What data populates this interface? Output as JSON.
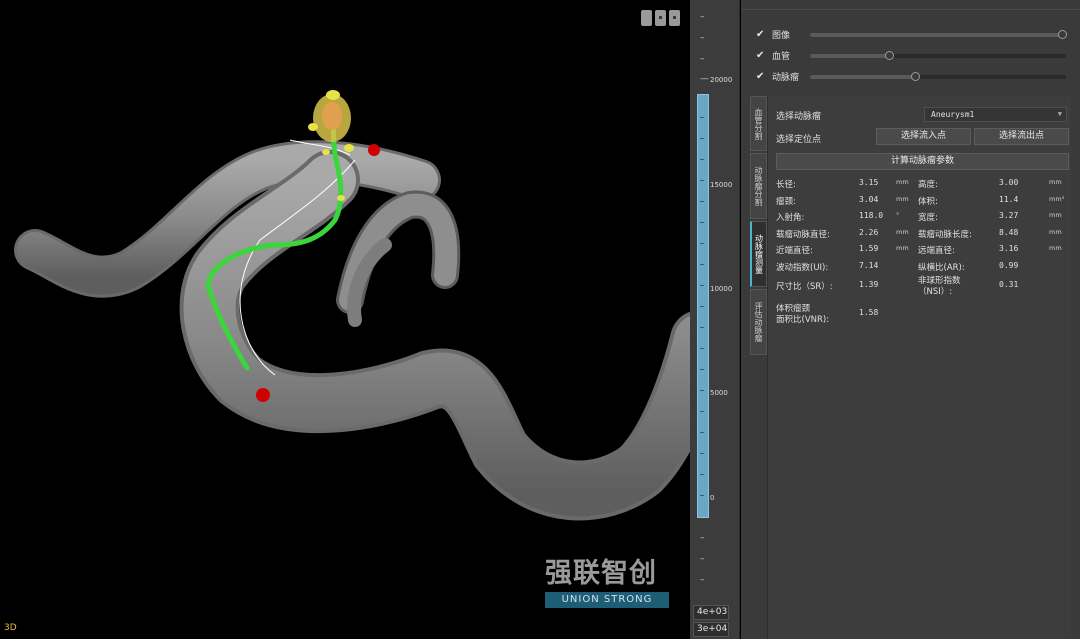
{
  "viewport": {
    "label": "3D",
    "logo_text": "强联智创",
    "logo_sub": "UNION STRONG"
  },
  "colorbar": {
    "labels": [
      "20000",
      "15000",
      "10000",
      "5000",
      "0"
    ],
    "sci_1": "4e+03",
    "sci_2": "3e+04",
    "color": "#6aa7c7"
  },
  "layers": [
    {
      "label": "图像",
      "checked": true,
      "value": 1.0
    },
    {
      "label": "血管",
      "checked": true,
      "value": 0.31
    },
    {
      "label": "动脉瘤",
      "checked": true,
      "value": 0.41
    }
  ],
  "tabs": [
    "血管分割",
    "动脉瘤分割",
    "动脉瘤测量",
    "评估动脉瘤"
  ],
  "active_tab": 2,
  "measure": {
    "select_aneurysm_label": "选择动脉瘤",
    "select_aneurysm_value": "Aneurysm1",
    "select_point_label": "选择定位点",
    "inflow_button": "选择流入点",
    "outflow_button": "选择流出点",
    "compute_button": "计算动脉瘤参数",
    "params": [
      {
        "label": "长径:",
        "value": "3.15",
        "unit": "mm",
        "label2": "高度:",
        "value2": "3.00",
        "unit2": "mm"
      },
      {
        "label": "瘤颈:",
        "value": "3.04",
        "unit": "mm",
        "label2": "体积:",
        "value2": "11.4",
        "unit2": "mm³"
      },
      {
        "label": "入射角:",
        "value": "118.0",
        "unit": "°",
        "label2": "宽度:",
        "value2": "3.27",
        "unit2": "mm"
      },
      {
        "label": "载瘤动脉直径:",
        "value": "2.26",
        "unit": "mm",
        "label2": "载瘤动脉长度:",
        "value2": "8.48",
        "unit2": "mm"
      },
      {
        "label": "近端直径:",
        "value": "1.59",
        "unit": "mm",
        "label2": "远端直径:",
        "value2": "3.16",
        "unit2": "mm"
      },
      {
        "label": "波动指数(UI):",
        "value": "7.14",
        "unit": "",
        "label2": "纵横比(AR):",
        "value2": "0.99",
        "unit2": ""
      }
    ],
    "sr_label": "尺寸比（SR）:",
    "sr_value": "1.39",
    "nsi_label_1": "非球形指数",
    "nsi_label_2": "（NSI）:",
    "nsi_value": "0.31",
    "vnr_label_1": "体积瘤颈",
    "vnr_label_2": "面积比(VNR):",
    "vnr_value": "1.58"
  }
}
